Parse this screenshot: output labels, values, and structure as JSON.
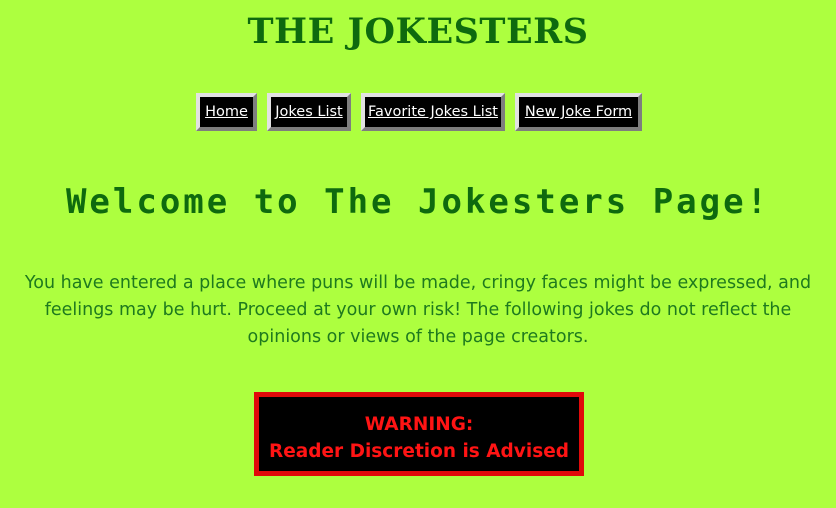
{
  "header": {
    "title": "THE JOKESTERS"
  },
  "nav": {
    "items": [
      {
        "label": "Home"
      },
      {
        "label": "Jokes List"
      },
      {
        "label": "Favorite Jokes List"
      },
      {
        "label": "New Joke Form"
      }
    ]
  },
  "main": {
    "welcome": "Welcome to The Jokesters Page!",
    "intro": "You have entered a place where puns will be made, cringy faces might be expressed, and feelings may be hurt. Proceed at your own risk! The following jokes do not reflect the opinions or views of the page creators.",
    "warning": {
      "line1": "WARNING:",
      "line2": "Reader Discretion is Advised"
    }
  },
  "colors": {
    "background": "#adff3f",
    "title": "#0e6a0e",
    "text": "#1e7a1e",
    "warning": "#ff1414"
  }
}
